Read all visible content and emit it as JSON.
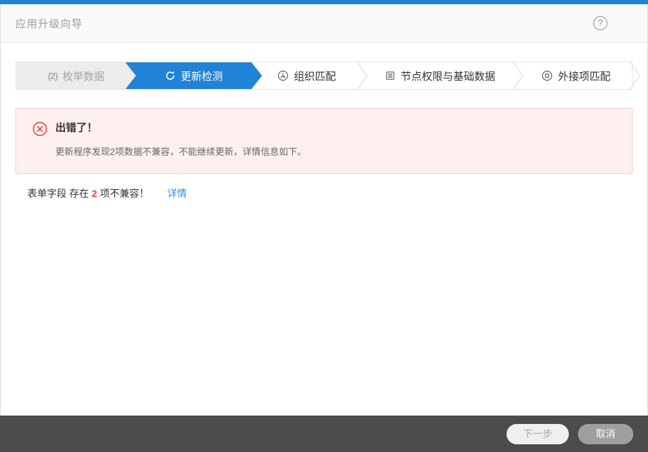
{
  "window": {
    "title": "应用升级向导",
    "help_glyph": "?"
  },
  "colors": {
    "accent_blue": "#2083d5",
    "link_blue": "#2f8fde",
    "error_red": "#e24848",
    "count_red": "#f23c3c",
    "alert_bg": "#fdf0ef",
    "alert_border": "#f6cdc9",
    "footer_bg": "#4c4c4c"
  },
  "steps": [
    {
      "label": "枚举数据",
      "icon": "enum-data-icon",
      "state": "done",
      "icon_glyph": "{2}"
    },
    {
      "label": "更新检测",
      "icon": "refresh-icon",
      "state": "active"
    },
    {
      "label": "组织匹配",
      "icon": "org-match-icon",
      "state": "pending"
    },
    {
      "label": "节点权限与基础数据",
      "icon": "list-doc-icon",
      "state": "pending"
    },
    {
      "label": "外接项匹配",
      "icon": "external-item-icon",
      "state": "pending"
    }
  ],
  "alert": {
    "title": "出错了！",
    "message": "更新程序发现2项数据不兼容，不能继续更新，详情信息如下。"
  },
  "issue_row": {
    "prefix": "表单字段 存在",
    "count": "2",
    "suffix": "项不兼容！",
    "link": "详情"
  },
  "footer": {
    "next_label": "下一步",
    "cancel_label": "取消"
  }
}
